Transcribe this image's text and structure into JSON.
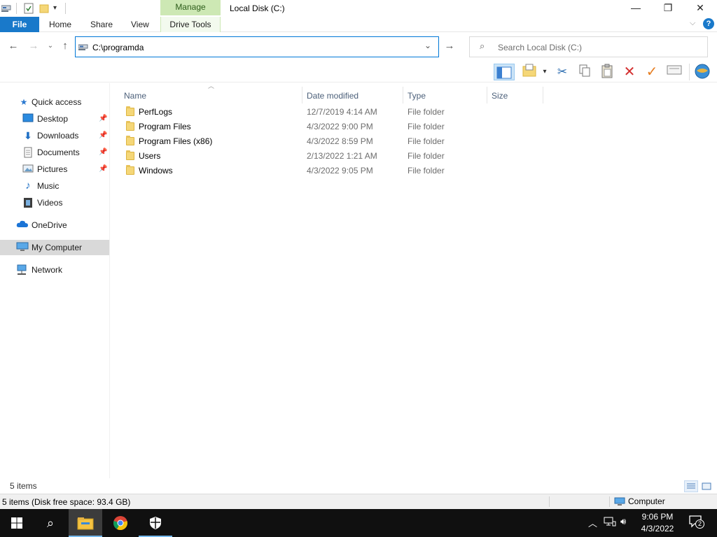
{
  "window": {
    "title": "Local Disk (C:)",
    "controls": {
      "minimize": "—",
      "restore": "❐",
      "close": "✕"
    }
  },
  "ribbon": {
    "context_group": "Manage",
    "tabs": [
      "File",
      "Home",
      "Share",
      "View",
      "Drive Tools"
    ]
  },
  "address": {
    "value": "C:\\programda",
    "search_placeholder": "Search Local Disk (C:)"
  },
  "sidebar": {
    "quick_access": "Quick access",
    "items": [
      {
        "label": "Desktop",
        "icon": "desktop-icon",
        "pinned": true
      },
      {
        "label": "Downloads",
        "icon": "downloads-icon",
        "pinned": true
      },
      {
        "label": "Documents",
        "icon": "documents-icon",
        "pinned": true
      },
      {
        "label": "Pictures",
        "icon": "pictures-icon",
        "pinned": true
      },
      {
        "label": "Music",
        "icon": "music-icon",
        "pinned": false
      },
      {
        "label": "Videos",
        "icon": "videos-icon",
        "pinned": false
      }
    ],
    "onedrive": "OneDrive",
    "my_computer": "My Computer",
    "network": "Network"
  },
  "columns": {
    "name": "Name",
    "date": "Date modified",
    "type": "Type",
    "size": "Size"
  },
  "files": [
    {
      "name": "PerfLogs",
      "date": "12/7/2019 4:14 AM",
      "type": "File folder"
    },
    {
      "name": "Program Files",
      "date": "4/3/2022 9:00 PM",
      "type": "File folder"
    },
    {
      "name": "Program Files (x86)",
      "date": "4/3/2022 8:59 PM",
      "type": "File folder"
    },
    {
      "name": "Users",
      "date": "2/13/2022 1:21 AM",
      "type": "File folder"
    },
    {
      "name": "Windows",
      "date": "4/3/2022 9:05 PM",
      "type": "File folder"
    }
  ],
  "status": {
    "item_count": "5 items",
    "detail": "5 items (Disk free space: 93.4 GB)",
    "location": "Computer"
  },
  "taskbar": {
    "time": "9:06 PM",
    "date": "4/3/2022",
    "notification_count": "2"
  },
  "colors": {
    "accent": "#0078d7",
    "file_tab": "#1979ca",
    "manage_tab": "#cde8b4",
    "taskbar": "#101010",
    "selection": "#d9d9d9"
  }
}
